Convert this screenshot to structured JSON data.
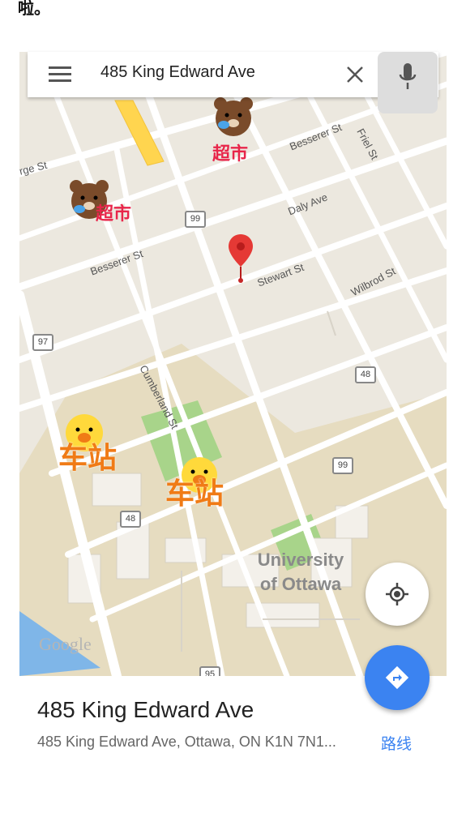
{
  "caption": "啦。",
  "search": {
    "query": "485 King Edward Ave"
  },
  "icons": {
    "menu": "menu-icon",
    "close": "close-icon",
    "mic": "mic-icon",
    "pin": "map-pin-icon",
    "locate": "my-location-icon",
    "directions": "directions-icon"
  },
  "map": {
    "streets": [
      "Besserer St",
      "Besserer St",
      "Daly Ave",
      "Stewart St",
      "Wilbrod St",
      "Friel St",
      "Cumberland St",
      "rge St"
    ],
    "route_shields": [
      "99",
      "97",
      "48",
      "99",
      "48",
      "95"
    ],
    "poi_supermarket": [
      "超市",
      "超市"
    ],
    "poi_station": [
      "车站",
      "车站"
    ],
    "campus_label": "University of Ottawa",
    "watermark": "Google"
  },
  "place": {
    "title": "485 King Edward Ave",
    "address": "485 King Edward Ave, Ottawa, ON K1N 7N1...",
    "route_label": "路线"
  },
  "colors": {
    "accent": "#3b83f1",
    "pin": "#e53935",
    "poi_red": "#e8254a",
    "poi_orange": "#f07b16"
  }
}
